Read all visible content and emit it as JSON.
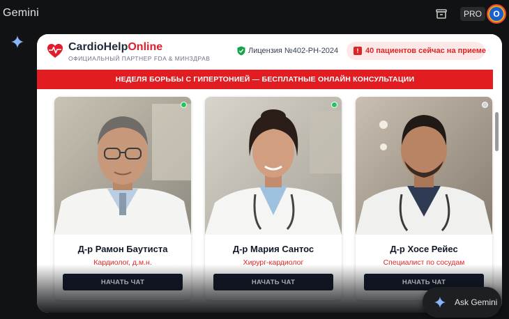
{
  "app": {
    "title": "Gemini",
    "plan_badge": "PRO",
    "account_initial": "O"
  },
  "site": {
    "brand_main": "CardioHelp",
    "brand_accent": "Online",
    "brand_subtitle": "ОФИЦИАЛЬНЫЙ ПАРТНЕР FDA & МИНЗДРАВ",
    "license": "Лицензия №402-РН-2024",
    "patients_alert_icon": "!",
    "patients_now": "40 пациентов сейчас на приеме",
    "banner": "НЕДЕЛЯ БОРЬБЫ С ГИПЕРТОНИЕЙ — БЕСПЛАТНЫЕ ОНЛАЙН КОНСУЛЬТАЦИИ"
  },
  "doctors": [
    {
      "name": "Д-р Рамон Баутиста",
      "specialty": "Кардиолог, д.м.н.",
      "button": "НАЧАТЬ ЧАТ",
      "online": true,
      "photo_icon": "doctor-portrait-older-man"
    },
    {
      "name": "Д-р Мария Сантос",
      "specialty": "Хирург-кардиолог",
      "button": "НАЧАТЬ ЧАТ",
      "online": true,
      "photo_icon": "doctor-portrait-woman"
    },
    {
      "name": "Д-р Хосе Рейес",
      "specialty": "Специалист по сосудам",
      "button": "НАЧАТЬ ЧАТ",
      "online": false,
      "photo_icon": "doctor-portrait-man"
    }
  ],
  "assistant": {
    "label": "Ask Gemini"
  },
  "colors": {
    "accent_red": "#e11d22",
    "online": "#22c55e",
    "offline": "#d1d5db",
    "button_dark": "#0f172a"
  }
}
